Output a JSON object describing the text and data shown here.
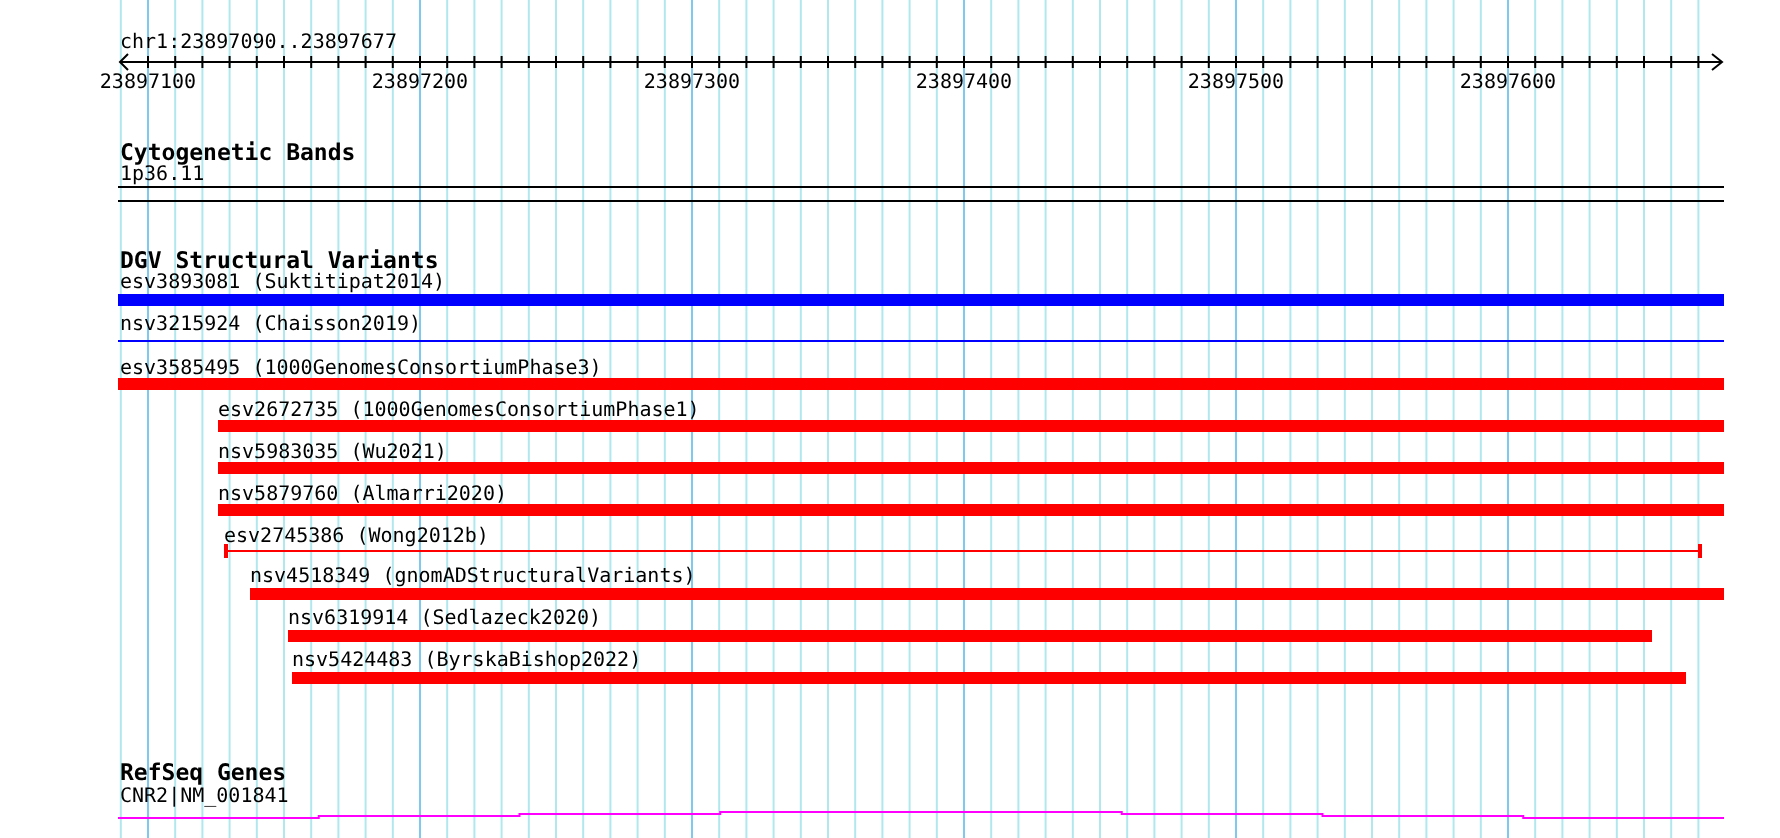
{
  "location": "chr1:23897090..23897677",
  "ruler": {
    "tick_labels": [
      "23897100",
      "23897200",
      "23897300",
      "23897400",
      "23897500",
      "23897600"
    ]
  },
  "tracks": [
    {
      "title": "Cytogenetic Bands",
      "kind": "bands",
      "features": [
        {
          "label": "1p36.11"
        }
      ]
    },
    {
      "title": "DGV Structural Variants",
      "kind": "variants",
      "features": [
        {
          "label": "esv3893081 (Suktitipat2014)",
          "color": "#0000ff",
          "kind": "thick"
        },
        {
          "label": "nsv3215924 (Chaisson2019)",
          "color": "#0000ff",
          "kind": "thin"
        },
        {
          "label": "esv3585495 (1000GenomesConsortiumPhase3)",
          "color": "#ff0000",
          "kind": "thick"
        },
        {
          "label": "esv2672735 (1000GenomesConsortiumPhase1)",
          "color": "#ff0000",
          "kind": "thick"
        },
        {
          "label": "nsv5983035 (Wu2021)",
          "color": "#ff0000",
          "kind": "thick"
        },
        {
          "label": "nsv5879760 (Almarri2020)",
          "color": "#ff0000",
          "kind": "thick"
        },
        {
          "label": "esv2745386 (Wong2012b)",
          "color": "#ff0000",
          "kind": "thin"
        },
        {
          "label": "nsv4518349 (gnomADStructuralVariants)",
          "color": "#ff0000",
          "kind": "thick"
        },
        {
          "label": "nsv6319914 (Sedlazeck2020)",
          "color": "#ff0000",
          "kind": "thick"
        },
        {
          "label": "nsv5424483 (ByrskaBishop2022)",
          "color": "#ff0000",
          "kind": "thick"
        }
      ]
    },
    {
      "title": "RefSeq Genes",
      "kind": "genes",
      "features": [
        {
          "label": "CNR2|NM_001841",
          "color": "#ff00ff"
        }
      ]
    }
  ]
}
